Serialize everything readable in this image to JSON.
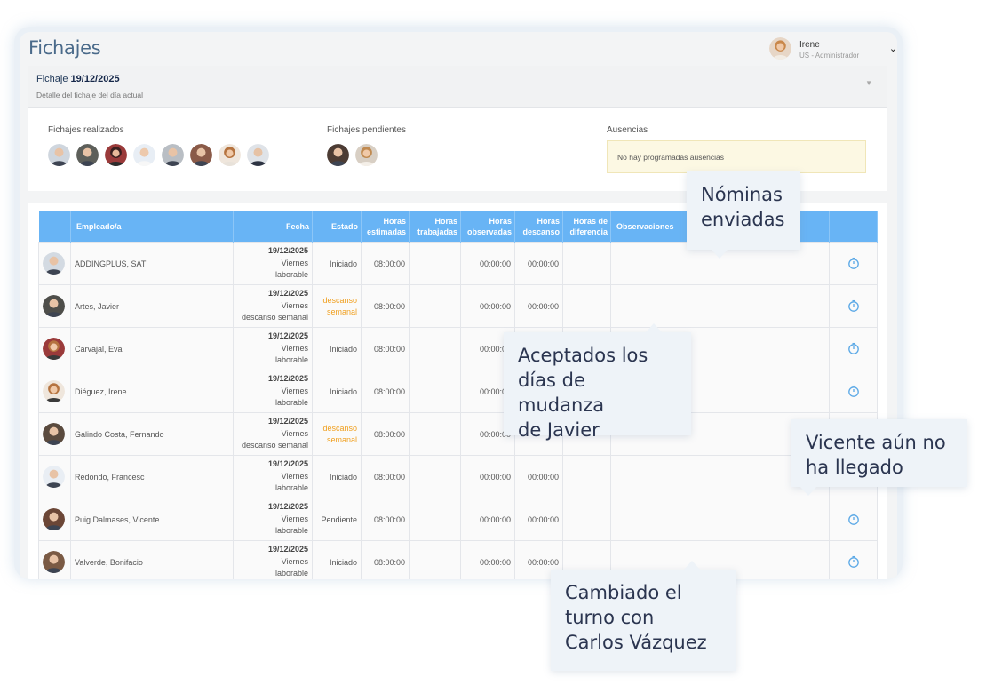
{
  "app": {
    "title": "Fichajes"
  },
  "user": {
    "name": "Irene",
    "role": "US - Administrador"
  },
  "fichaje": {
    "label": "Fichaje",
    "date": "19/12/2025",
    "subtitle": "Detalle del fichaje del día actual"
  },
  "sections": {
    "realizados": "Fichajes realizados",
    "pendientes": "Fichajes pendientes",
    "ausencias": "Ausencias",
    "ausencias_empty": "No hay programadas ausencias"
  },
  "table": {
    "headers": {
      "empleado": "Empleado/a",
      "fecha": "Fecha",
      "estado": "Estado",
      "estimadas_1": "Horas",
      "estimadas_2": "estimadas",
      "trabajadas_1": "Horas",
      "trabajadas_2": "trabajadas",
      "observadas_1": "Horas",
      "observadas_2": "observadas",
      "descanso_1": "Horas",
      "descanso_2": "descanso",
      "diferencia_1": "Horas de",
      "diferencia_2": "diferencia",
      "observaciones": "Observaciones"
    },
    "rows": [
      {
        "name": "ADDINGPLUS, SAT",
        "date": "19/12/2025",
        "day": "Viernes",
        "type": "laborable",
        "estado": "Iniciado",
        "estado_2": "",
        "estimadas": "08:00:00",
        "trabajadas": "",
        "observadas": "00:00:00",
        "descanso": "00:00:00",
        "diferencia": "",
        "observaciones": ""
      },
      {
        "name": "Artes, Javier",
        "date": "19/12/2025",
        "day": "Viernes",
        "type": "descanso semanal",
        "estado": "descanso",
        "estado_2": "semanal",
        "estimadas": "08:00:00",
        "trabajadas": "",
        "observadas": "00:00:00",
        "descanso": "00:00:00",
        "diferencia": "",
        "observaciones": ""
      },
      {
        "name": "Carvajal, Eva",
        "date": "19/12/2025",
        "day": "Viernes",
        "type": "laborable",
        "estado": "Iniciado",
        "estado_2": "",
        "estimadas": "08:00:00",
        "trabajadas": "",
        "observadas": "00:00:00",
        "descanso": "",
        "diferencia": "",
        "observaciones": ""
      },
      {
        "name": "Diéguez, Irene",
        "date": "19/12/2025",
        "day": "Viernes",
        "type": "laborable",
        "estado": "Iniciado",
        "estado_2": "",
        "estimadas": "08:00:00",
        "trabajadas": "",
        "observadas": "00:00:00",
        "descanso": "",
        "diferencia": "",
        "observaciones": ""
      },
      {
        "name": "Galindo Costa, Fernando",
        "date": "19/12/2025",
        "day": "Viernes",
        "type": "descanso semanal",
        "estado": "descanso",
        "estado_2": "semanal",
        "estimadas": "08:00:00",
        "trabajadas": "",
        "observadas": "00:00:00",
        "descanso": "",
        "diferencia": "",
        "observaciones": ""
      },
      {
        "name": "Redondo, Francesc",
        "date": "19/12/2025",
        "day": "Viernes",
        "type": "laborable",
        "estado": "Iniciado",
        "estado_2": "",
        "estimadas": "08:00:00",
        "trabajadas": "",
        "observadas": "00:00:00",
        "descanso": "00:00:00",
        "diferencia": "",
        "observaciones": ""
      },
      {
        "name": "Puig Dalmases, Vicente",
        "date": "19/12/2025",
        "day": "Viernes",
        "type": "laborable",
        "estado": "Pendiente",
        "estado_2": "",
        "estimadas": "08:00:00",
        "trabajadas": "",
        "observadas": "00:00:00",
        "descanso": "00:00:00",
        "diferencia": "",
        "observaciones": ""
      },
      {
        "name": "Valverde, Bonifacio",
        "date": "19/12/2025",
        "day": "Viernes",
        "type": "laborable",
        "estado": "Iniciado",
        "estado_2": "",
        "estimadas": "08:00:00",
        "trabajadas": "",
        "observadas": "00:00:00",
        "descanso": "00:00:00",
        "diferencia": "",
        "observaciones": ""
      }
    ]
  },
  "callouts": {
    "nominas_1": "Nóminas",
    "nominas_2": "enviadas",
    "javier_1": "Aceptados los",
    "javier_2": "días de mudanza",
    "javier_3": "de Javier",
    "vicente_1": "Vicente aún no",
    "vicente_2": "ha llegado",
    "turno_1": "Cambiado el",
    "turno_2": "turno con",
    "turno_3": "Carlos Vázquez"
  },
  "colors": {
    "header_blue": "#68b4f5",
    "accent_orange": "#f0a020",
    "notice_yellow": "#fcf8e3",
    "title_blue": "#4a6a8a",
    "clock_blue": "#5aa8e6"
  },
  "icons": {
    "row_action": "stopwatch-icon",
    "user_menu": "chevron-down-icon",
    "collapse": "caret-down-icon"
  }
}
